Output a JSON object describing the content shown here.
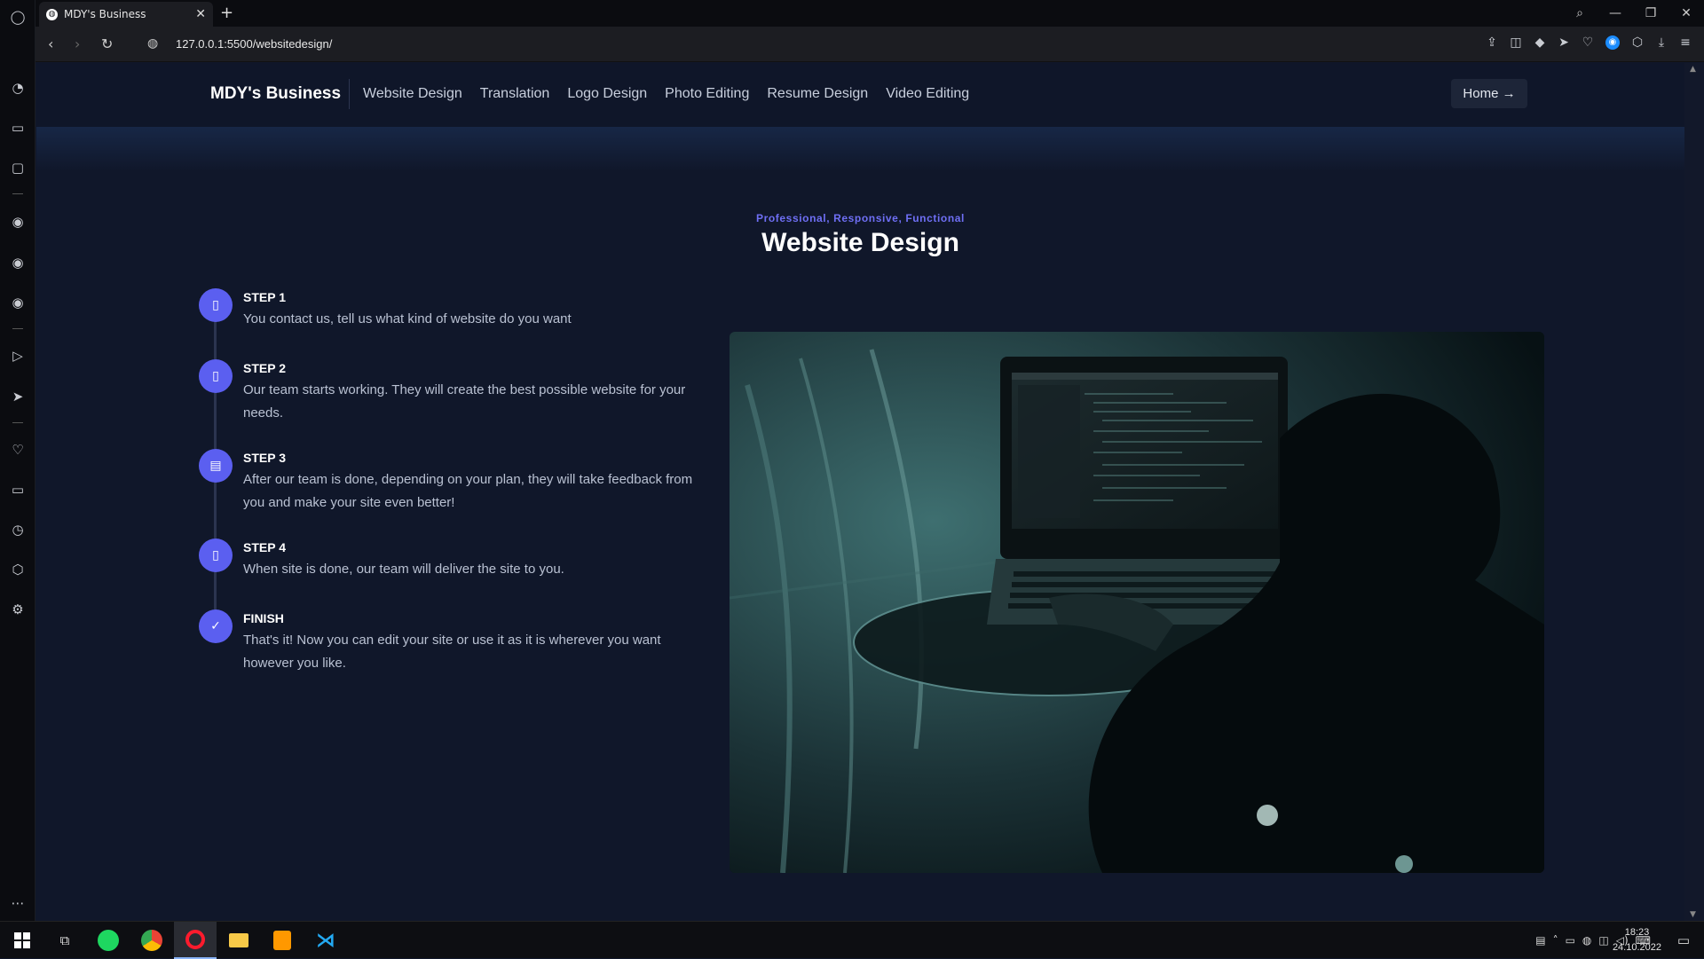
{
  "browser": {
    "tab_title": "MDY's Business",
    "new_tab": "+",
    "url": "127.0.0.1:5500/websitedesign/",
    "window_controls": [
      "search-icon",
      "minimize-icon",
      "restore-icon",
      "close-icon"
    ]
  },
  "header": {
    "brand": "MDY's Business",
    "nav": [
      "Website Design",
      "Translation",
      "Logo Design",
      "Photo Editing",
      "Resume Design",
      "Video Editing"
    ],
    "home_label": "Home →"
  },
  "hero": {
    "eyebrow": "Professional, Responsive, Functional",
    "title": "Website Design"
  },
  "steps": [
    {
      "title": "STEP 1",
      "text": "You contact us, tell us what kind of website do you want",
      "icon": "square-icon"
    },
    {
      "title": "STEP 2",
      "text": "Our team starts working. They will create the best possible website for your needs.",
      "icon": "square-icon"
    },
    {
      "title": "STEP 3",
      "text": "After our team is done, depending on your plan, they will take feedback from you and make your site even better!",
      "icon": "clipboard-icon"
    },
    {
      "title": "STEP 4",
      "text": "When site is done, our team will deliver the site to you.",
      "icon": "square-icon"
    },
    {
      "title": "FINISH",
      "text": "That's it! Now you can edit your site or use it as it is wherever you want however you like.",
      "icon": "check-circle-icon"
    }
  ],
  "taskbar": {
    "time": "18:23",
    "date": "24.10.2022"
  },
  "colors": {
    "accent": "#5b5ff0",
    "page_bg": "#10172a",
    "eyebrow": "#6f6ff5"
  }
}
